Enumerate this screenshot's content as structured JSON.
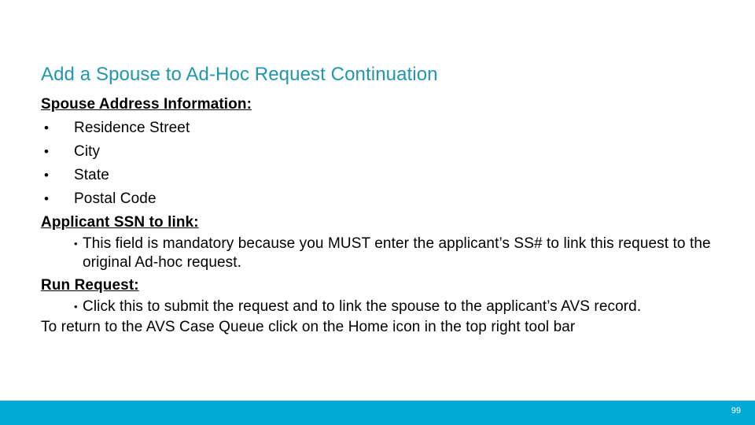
{
  "slide": {
    "title": "Add a Spouse to Ad-Hoc Request Continuation",
    "title_color": "#2196ac",
    "background_color": "#ffffff"
  },
  "body": {
    "section_address": {
      "heading": "Spouse Address Information:",
      "bullet_marker": "•",
      "items": [
        "Residence Street",
        "City",
        "State",
        "Postal Code"
      ]
    },
    "section_ssn": {
      "heading": "Applicant SSN to link:",
      "bullet_marker": "•",
      "detail": "This field is mandatory because you MUST enter the applicant’s SS# to link this request to the original Ad-hoc request."
    },
    "section_run": {
      "heading": "Run Request:",
      "bullet_marker": "•",
      "detail": "Click this to submit the request and to link the spouse to the applicant’s AVS record."
    },
    "closing_paragraph": "To return to the AVS Case Queue click on the Home icon in the top right tool bar"
  },
  "footer": {
    "bar_color": "#00a8d6",
    "page_number": "99"
  }
}
